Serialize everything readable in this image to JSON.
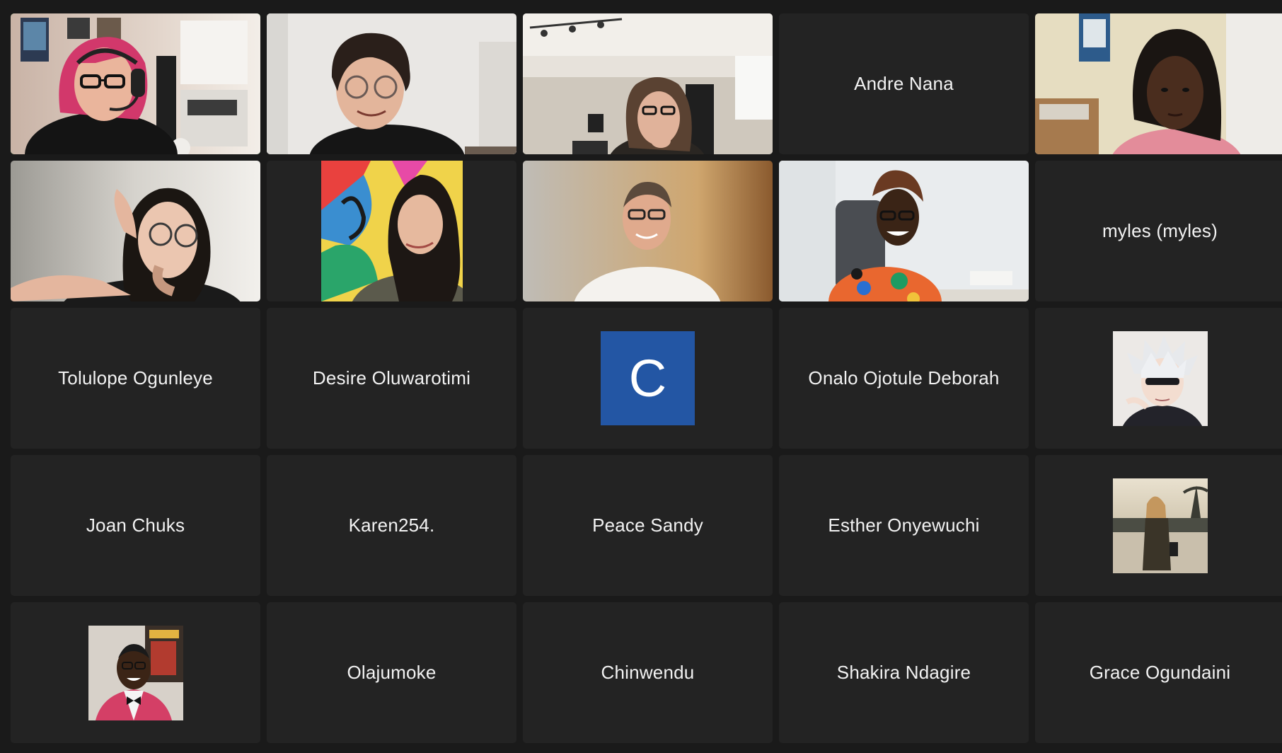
{
  "meeting": {
    "layout": "gallery view",
    "active_speaker_color": "#3fbb4d",
    "tile_background": "#232323"
  },
  "participants": [
    {
      "name": "",
      "display": "video",
      "active_speaker": true,
      "icon": "woman-with-headset-video"
    },
    {
      "name": "",
      "display": "video",
      "icon": "person-with-glasses-video"
    },
    {
      "name": "",
      "display": "video",
      "icon": "woman-in-room-video"
    },
    {
      "name": "Andre Nana",
      "display": "name"
    },
    {
      "name": "",
      "display": "video",
      "icon": "woman-video"
    },
    {
      "name": "",
      "display": "video",
      "icon": "woman-with-glasses-video"
    },
    {
      "name": "",
      "display": "video",
      "icon": "woman-mural-video"
    },
    {
      "name": "",
      "display": "video",
      "icon": "man-smiling-video"
    },
    {
      "name": "",
      "display": "video",
      "icon": "woman-office-chair-video"
    },
    {
      "name": "myles (myles)",
      "display": "name"
    },
    {
      "name": "Tolulope Ogunleye",
      "display": "name"
    },
    {
      "name": "Desire Oluwarotimi",
      "display": "name"
    },
    {
      "name": "",
      "display": "letter-avatar",
      "letter": "C",
      "color": "#2356a4"
    },
    {
      "name": "Onalo Ojotule Deborah",
      "display": "name"
    },
    {
      "name": "",
      "display": "profile-picture",
      "icon": "anime-character-avatar"
    },
    {
      "name": "Joan Chuks",
      "display": "name"
    },
    {
      "name": "Karen254.",
      "display": "name"
    },
    {
      "name": "Peace Sandy",
      "display": "name"
    },
    {
      "name": "Esther Onyewuchi",
      "display": "name"
    },
    {
      "name": "",
      "display": "profile-picture",
      "icon": "beach-photo-avatar"
    },
    {
      "name": "",
      "display": "profile-picture",
      "icon": "man-in-suit-avatar"
    },
    {
      "name": "Olajumoke",
      "display": "name"
    },
    {
      "name": "Chinwendu",
      "display": "name"
    },
    {
      "name": "Shakira Ndagire",
      "display": "name"
    },
    {
      "name": "Grace Ogundaini",
      "display": "name"
    }
  ]
}
